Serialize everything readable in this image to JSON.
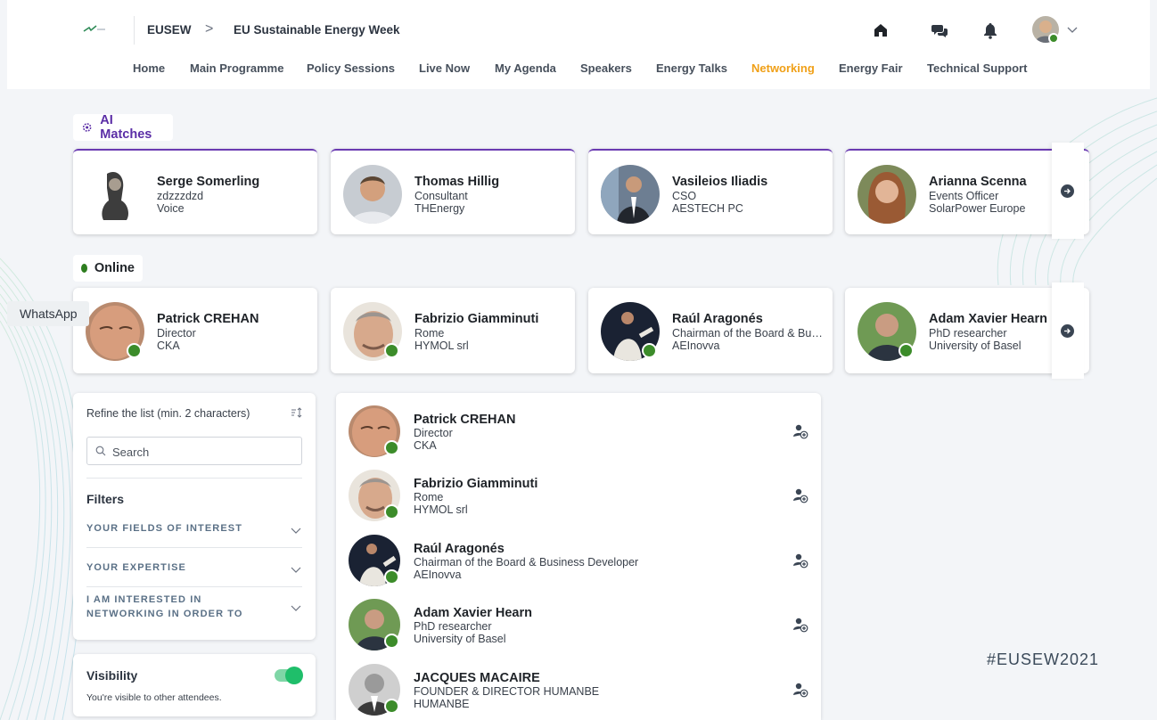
{
  "header": {
    "breadcrumb_root": "EUSEW",
    "breadcrumb_separator": ">",
    "breadcrumb_current": "EU Sustainable Energy Week",
    "icons": [
      "home-icon",
      "chat-icon",
      "bell-icon"
    ]
  },
  "nav": {
    "items": [
      {
        "label": "Home"
      },
      {
        "label": "Main Programme"
      },
      {
        "label": "Policy Sessions"
      },
      {
        "label": "Live Now"
      },
      {
        "label": "My Agenda"
      },
      {
        "label": "Speakers"
      },
      {
        "label": "Energy Talks"
      },
      {
        "label": "Networking",
        "active": true
      },
      {
        "label": "Energy Fair"
      },
      {
        "label": "Technical Support"
      }
    ],
    "active_color": "#f0a018"
  },
  "ai_matches": {
    "title": "AI Matches",
    "accent": "#5b2ea6",
    "cards": [
      {
        "name": "Serge Somerling",
        "line2": "zdzzzdzd",
        "line3": "Voice"
      },
      {
        "name": "Thomas Hillig",
        "line2": "Consultant",
        "line3": "THEnergy"
      },
      {
        "name": "Vasileios Iliadis",
        "line2": "CSO",
        "line3": "AESTECH PC"
      },
      {
        "name": "Arianna Scenna",
        "line2": "Events Officer",
        "line3": "SolarPower Europe"
      }
    ]
  },
  "online": {
    "title": "Online",
    "status_color": "#2e7d1f",
    "cards": [
      {
        "name": "Patrick CREHAN",
        "line2": "Director",
        "line3": "CKA"
      },
      {
        "name": "Fabrizio Giamminuti",
        "line2": "Rome",
        "line3": "HYMOL srl"
      },
      {
        "name": "Raúl Aragonés",
        "line2": "Chairman of the Board & Business Developer",
        "line3": "AEInovva"
      },
      {
        "name": "Adam Xavier Hearn",
        "line2": "PhD researcher",
        "line3": "University of Basel"
      }
    ]
  },
  "whatsapp": {
    "label": "WhatsApp"
  },
  "filters": {
    "refine_label": "Refine the list (min. 2 characters)",
    "search_placeholder": "Search",
    "search_value": "",
    "title": "Filters",
    "groups": [
      {
        "label": "YOUR FIELDS OF INTEREST"
      },
      {
        "label": "YOUR EXPERTISE"
      },
      {
        "label": "I AM INTERESTED IN NETWORKING IN ORDER TO"
      }
    ]
  },
  "visibility": {
    "title": "Visibility",
    "description": "You're visible to other attendees.",
    "enabled": true
  },
  "list": {
    "rows": [
      {
        "name": "Patrick CREHAN",
        "line2": "Director",
        "line3": "CKA"
      },
      {
        "name": "Fabrizio Giamminuti",
        "line2": "Rome",
        "line3": "HYMOL srl"
      },
      {
        "name": "Raúl Aragonés",
        "line2": "Chairman of the Board & Business Developer",
        "line3": "AEInovva"
      },
      {
        "name": "Adam Xavier Hearn",
        "line2": "PhD researcher",
        "line3": "University of Basel"
      },
      {
        "name": "JACQUES MACAIRE",
        "line2": "FOUNDER & DIRECTOR HUMANBE",
        "line3": "HUMANBE"
      }
    ]
  },
  "hashtag": "#EUSEW2021"
}
